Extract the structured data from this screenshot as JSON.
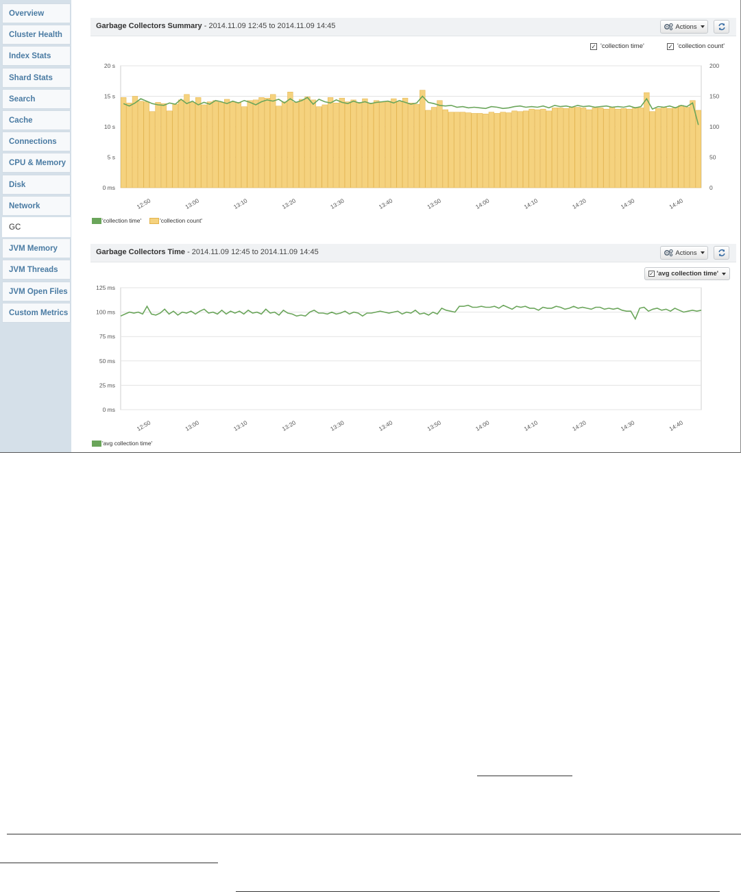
{
  "sidebar": {
    "items": [
      {
        "label": "Overview",
        "active": false
      },
      {
        "label": "Cluster Health",
        "active": false
      },
      {
        "label": "Index Stats",
        "active": false
      },
      {
        "label": "Shard Stats",
        "active": false
      },
      {
        "label": "Search",
        "active": false
      },
      {
        "label": "Cache",
        "active": false
      },
      {
        "label": "Connections",
        "active": false
      },
      {
        "label": "CPU & Memory",
        "active": false
      },
      {
        "label": "Disk",
        "active": false
      },
      {
        "label": "Network",
        "active": false
      },
      {
        "label": "GC",
        "active": true
      },
      {
        "label": "JVM Memory",
        "active": false
      },
      {
        "label": "JVM Threads",
        "active": false
      },
      {
        "label": "JVM Open Files",
        "active": false
      },
      {
        "label": "Custom Metrics",
        "active": false
      }
    ]
  },
  "panels": {
    "summary": {
      "title": "Garbage Collectors Summary",
      "subtitle": " - 2014.11.09 12:45 to 2014.11.09 14:45",
      "actions_label": "Actions",
      "toggles": [
        "'collection time'",
        "'collection count'"
      ],
      "legend": [
        "'collection time'",
        "'collection count'"
      ]
    },
    "time": {
      "title": "Garbage Collectors Time",
      "subtitle": " - 2014.11.09 12:45 to 2014.11.09 14:45",
      "actions_label": "Actions",
      "series_select": "'avg collection time'",
      "legend": [
        "'avg collection time'"
      ]
    }
  },
  "colors": {
    "accent_link": "#4a7ba3",
    "bar_fill": "#f5d27e",
    "bar_stroke": "#e2b24a",
    "line": "#6aa55a",
    "sidebar_bg": "#d5e0e9"
  },
  "icons": {
    "actions": "gears-icon",
    "refresh": "refresh-icon",
    "checkbox": "checkbox-checked-icon"
  },
  "chart_data": [
    {
      "type": "bar",
      "title": "Garbage Collectors Summary",
      "x_tick_labels": [
        "12:50",
        "13:00",
        "13:10",
        "13:20",
        "13:30",
        "13:40",
        "13:50",
        "14:00",
        "14:10",
        "14:20",
        "14:30",
        "14:40"
      ],
      "y_left_ticks": [
        "0 ms",
        "5 s",
        "10 s",
        "15 s",
        "20 s"
      ],
      "y_right_ticks": [
        "0",
        "50",
        "100",
        "150",
        "200"
      ],
      "ylim_left": [
        0,
        20
      ],
      "ylim_right": [
        0,
        200
      ],
      "grid": true,
      "legend_position": "bottom-left",
      "series": [
        {
          "name": "'collection count'",
          "axis": "right",
          "kind": "bar",
          "values": [
            148,
            139,
            150,
            142,
            141,
            125,
            140,
            138,
            126,
            137,
            144,
            153,
            140,
            148,
            136,
            141,
            143,
            140,
            145,
            141,
            140,
            133,
            143,
            144,
            148,
            147,
            153,
            134,
            141,
            157,
            140,
            145,
            149,
            144,
            133,
            136,
            148,
            139,
            147,
            141,
            144,
            140,
            146,
            139,
            143,
            140,
            142,
            146,
            141,
            147,
            139,
            137,
            160,
            127,
            132,
            143,
            128,
            124,
            124,
            124,
            123,
            122,
            122,
            121,
            124,
            122,
            124,
            123,
            126,
            125,
            126,
            129,
            128,
            129,
            126,
            131,
            131,
            130,
            132,
            132,
            131,
            128,
            131,
            131,
            129,
            132,
            129,
            130,
            129,
            132,
            131,
            156,
            125,
            130,
            132,
            130,
            132,
            135,
            132,
            143,
            127
          ]
        },
        {
          "name": "'collection time'",
          "axis": "left",
          "kind": "line",
          "values": [
            13.8,
            13.4,
            13.9,
            14.6,
            14.2,
            13.8,
            13.6,
            13.5,
            13.9,
            13.7,
            14.5,
            13.8,
            14.2,
            13.6,
            14.0,
            13.7,
            14.3,
            14.1,
            13.8,
            14.2,
            13.9,
            14.3,
            14.0,
            13.6,
            14.1,
            14.4,
            14.2,
            14.5,
            13.9,
            14.6,
            14.0,
            14.3,
            14.8,
            13.7,
            14.5,
            14.1,
            13.9,
            14.4,
            14.0,
            13.8,
            14.2,
            13.9,
            14.1,
            13.8,
            14.0,
            14.1,
            14.2,
            13.9,
            14.3,
            14.0,
            13.7,
            13.9,
            15.0,
            14.0,
            13.8,
            13.5,
            13.4,
            13.5,
            13.2,
            13.3,
            13.1,
            13.2,
            13.1,
            13.0,
            13.3,
            13.2,
            13.0,
            13.1,
            13.3,
            13.4,
            13.2,
            13.3,
            13.2,
            13.4,
            13.1,
            13.5,
            13.3,
            13.4,
            13.2,
            13.5,
            13.3,
            13.4,
            13.2,
            13.3,
            13.4,
            13.2,
            13.3,
            13.2,
            13.4,
            13.1,
            13.3,
            14.6,
            12.9,
            13.3,
            13.2,
            13.4,
            13.1,
            13.5,
            13.3,
            13.9,
            10.3
          ]
        }
      ]
    },
    {
      "type": "line",
      "title": "Garbage Collectors Time",
      "x_tick_labels": [
        "12:50",
        "13:00",
        "13:10",
        "13:20",
        "13:30",
        "13:40",
        "13:50",
        "14:00",
        "14:10",
        "14:20",
        "14:30",
        "14:40"
      ],
      "y_ticks": [
        "0 ms",
        "25 ms",
        "50 ms",
        "75 ms",
        "100 ms",
        "125 ms"
      ],
      "ylim": [
        0,
        125
      ],
      "grid": true,
      "legend_position": "bottom-left",
      "series": [
        {
          "name": "'avg collection time'",
          "values": [
            96,
            98,
            100,
            99,
            100,
            98,
            106,
            98,
            97,
            99,
            103,
            98,
            101,
            97,
            100,
            99,
            101,
            98,
            101,
            103,
            99,
            100,
            98,
            102,
            98,
            101,
            99,
            101,
            98,
            102,
            99,
            100,
            98,
            103,
            99,
            100,
            97,
            102,
            99,
            98,
            96,
            97,
            96,
            100,
            102,
            99,
            99,
            98,
            100,
            98,
            99,
            101,
            98,
            100,
            99,
            96,
            99,
            99,
            100,
            101,
            100,
            99,
            100,
            101,
            98,
            100,
            99,
            102,
            98,
            99,
            97,
            100,
            98,
            104,
            102,
            101,
            100,
            106,
            106,
            107,
            105,
            105,
            106,
            105,
            105,
            106,
            104,
            107,
            105,
            103,
            106,
            105,
            106,
            104,
            104,
            102,
            105,
            104,
            104,
            106,
            105,
            103,
            104,
            106,
            104,
            105,
            104,
            103,
            105,
            105,
            103,
            104,
            103,
            104,
            102,
            101,
            101,
            93,
            104,
            105,
            101,
            103,
            104,
            102,
            103,
            101,
            104,
            102,
            100,
            101,
            102,
            101,
            102
          ]
        }
      ]
    }
  ]
}
